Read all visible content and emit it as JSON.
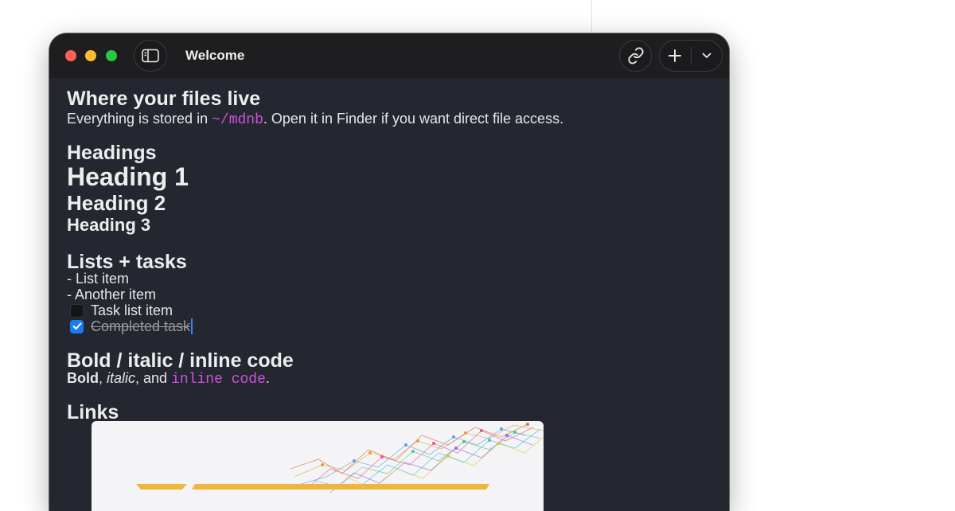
{
  "window": {
    "title": "Welcome"
  },
  "toolbar": {
    "sidebar_icon": "sidebar-toggle-icon",
    "link_icon": "link-icon",
    "add_icon": "plus-icon",
    "menu_icon": "chevron-down-icon"
  },
  "doc": {
    "files_heading": "Where your files live",
    "files_text_before": "Everything is stored in ",
    "files_path": "~/mdnb",
    "files_text_after": ". Open it in Finder if you want direct file access.",
    "headings_heading": "Headings",
    "heading1": "Heading 1",
    "heading2": "Heading 2",
    "heading3": "Heading 3",
    "lists_heading": "Lists + tasks",
    "list_item_1": "- List item",
    "list_item_2": "- Another item",
    "task_1": {
      "label": "Task list item",
      "checked": false
    },
    "task_2": {
      "label": "Completed task",
      "checked": true
    },
    "format_heading": "Bold / italic / inline code",
    "format_bold": "Bold",
    "format_sep1": ", ",
    "format_italic": "italic",
    "format_sep2": ", and ",
    "format_code": "inline code",
    "format_end": ".",
    "links_heading": "Links"
  },
  "colors": {
    "window_bg": "#24272f",
    "titlebar_bg": "#1e1e20",
    "code_accent": "#cf52df",
    "checkbox_blue": "#1a7cf5"
  }
}
